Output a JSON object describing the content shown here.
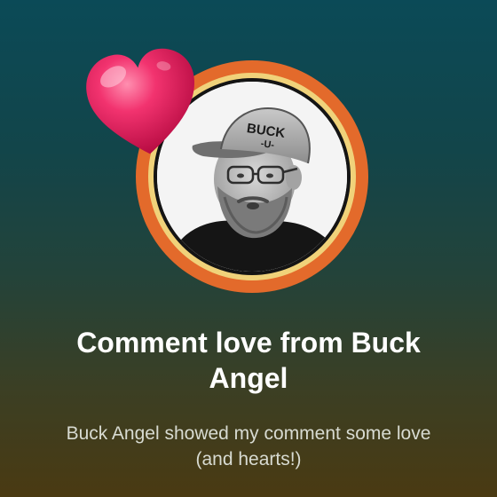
{
  "card": {
    "title": "Comment love from Buck Angel",
    "description": "Buck Angel showed my comment some love (and hearts!)"
  },
  "avatar": {
    "hat_text": "BUCK U",
    "ring_colors": {
      "outer": "#e36a2b",
      "inner": "#f0d27a"
    }
  },
  "heart": {
    "color": "#e8195a"
  },
  "colors": {
    "background_top": "#0b4a57",
    "background_bottom": "#4a3a12",
    "title": "#ffffff",
    "description": "#d8dbd2"
  }
}
